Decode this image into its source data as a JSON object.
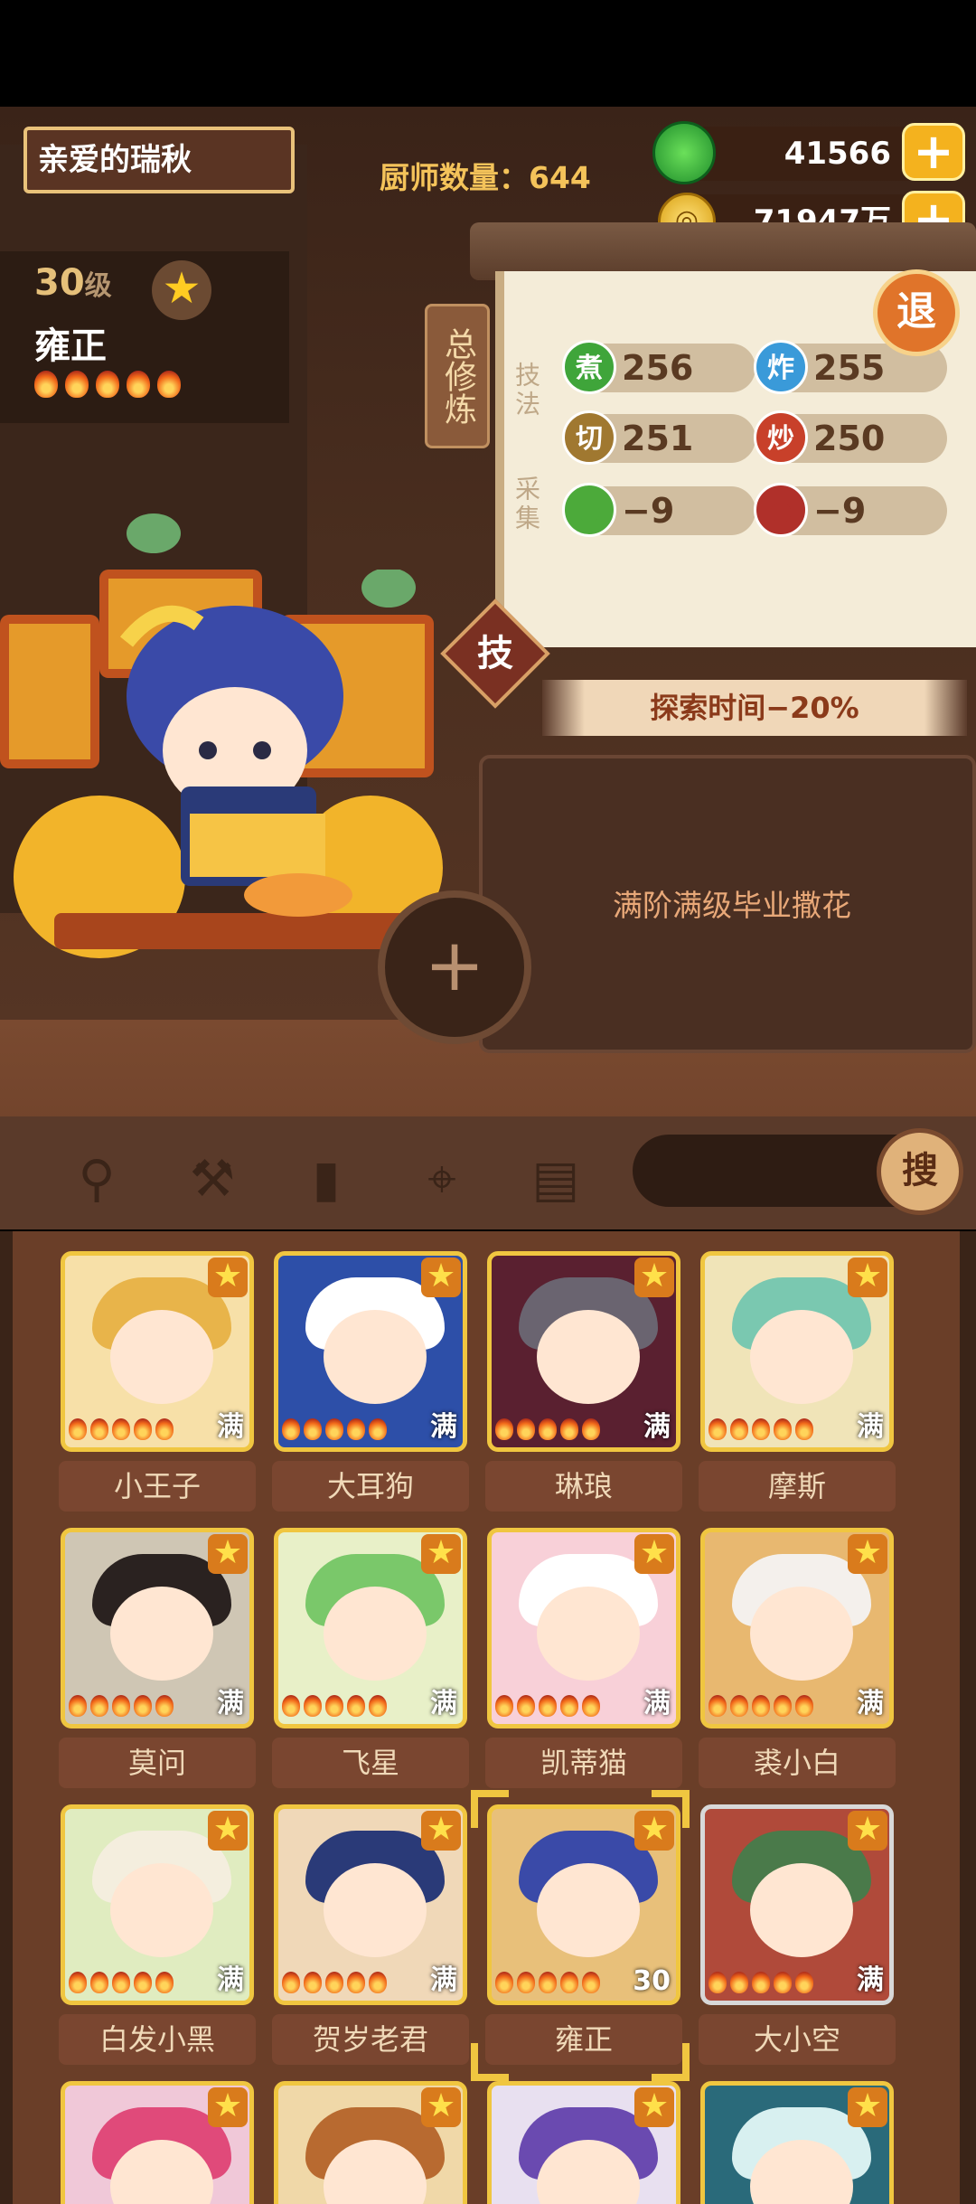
{
  "header": {
    "player_name": "亲爱的瑞秋",
    "chef_count_label": "厨师数量：",
    "chef_count": "644",
    "jade_amount": "41566",
    "coin_amount": "71947万",
    "plus_symbol": "+"
  },
  "chef": {
    "level": "30",
    "level_unit": "级",
    "name": "雍正",
    "flame_count": 5
  },
  "training": {
    "title": "总修炼",
    "skill_label": "技法",
    "gather_label": "采集",
    "exit_label": "退",
    "skill_tab": "技",
    "stats": [
      {
        "icon": "煮",
        "value": "256",
        "color": "#3fa53a"
      },
      {
        "icon": "炸",
        "value": "255",
        "color": "#3a9ad9"
      },
      {
        "icon": "切",
        "value": "251",
        "color": "#a07830"
      },
      {
        "icon": "炒",
        "value": "250",
        "color": "#c8402a"
      },
      {
        "icon": "菜",
        "value": "−9",
        "color": "#4caa3a"
      },
      {
        "icon": "肉",
        "value": "−9",
        "color": "#b0302a"
      }
    ],
    "explore_bonus": "探索时间−20%",
    "comment": "满阶满级毕业撒花"
  },
  "toolbar": {
    "icons": [
      "meat-icon",
      "shovel-icon",
      "jar-icon",
      "location-icon",
      "map-quest-icon"
    ],
    "search_label": "搜"
  },
  "chef_list": [
    {
      "name": "小王子",
      "badge": "满",
      "bg": "#f7e0a8",
      "hair": "#e8b44a"
    },
    {
      "name": "大耳狗",
      "badge": "满",
      "bg": "#2d4fa8",
      "hair": "#ffffff"
    },
    {
      "name": "琳琅",
      "badge": "满",
      "bg": "#5a2030",
      "hair": "#6a6470"
    },
    {
      "name": "摩斯",
      "badge": "满",
      "bg": "#f0e4b8",
      "hair": "#7ac8b0"
    },
    {
      "name": "莫问",
      "badge": "满",
      "bg": "#cfc6b4",
      "hair": "#2a2220"
    },
    {
      "name": "飞星",
      "badge": "满",
      "bg": "#e8f0c8",
      "hair": "#7ac86a"
    },
    {
      "name": "凯蒂猫",
      "badge": "满",
      "bg": "#f8d0d8",
      "hair": "#ffffff"
    },
    {
      "name": "裘小白",
      "badge": "满",
      "bg": "#e8b870",
      "hair": "#f4f0ec"
    },
    {
      "name": "白发小黑",
      "badge": "满",
      "bg": "#e0ecc0",
      "hair": "#f4eede"
    },
    {
      "name": "贺岁老君",
      "badge": "满",
      "bg": "#f0d8b8",
      "hair": "#2a3a78"
    },
    {
      "name": "雍正",
      "badge": "30",
      "bg": "#e8c07a",
      "hair": "#3a4aa8"
    },
    {
      "name": "大小空",
      "badge": "满",
      "bg": "#b04a3a",
      "hair": "#4a7a4a"
    },
    {
      "name": "",
      "badge": "",
      "bg": "#f0c8d8",
      "hair": "#e04a7a"
    },
    {
      "name": "",
      "badge": "",
      "bg": "#f0d8a8",
      "hair": "#b86a30"
    },
    {
      "name": "",
      "badge": "",
      "bg": "#e8e0f0",
      "hair": "#6a4ab0"
    },
    {
      "name": "",
      "badge": "",
      "bg": "#2a6a7a",
      "hair": "#d8f0f0"
    }
  ]
}
